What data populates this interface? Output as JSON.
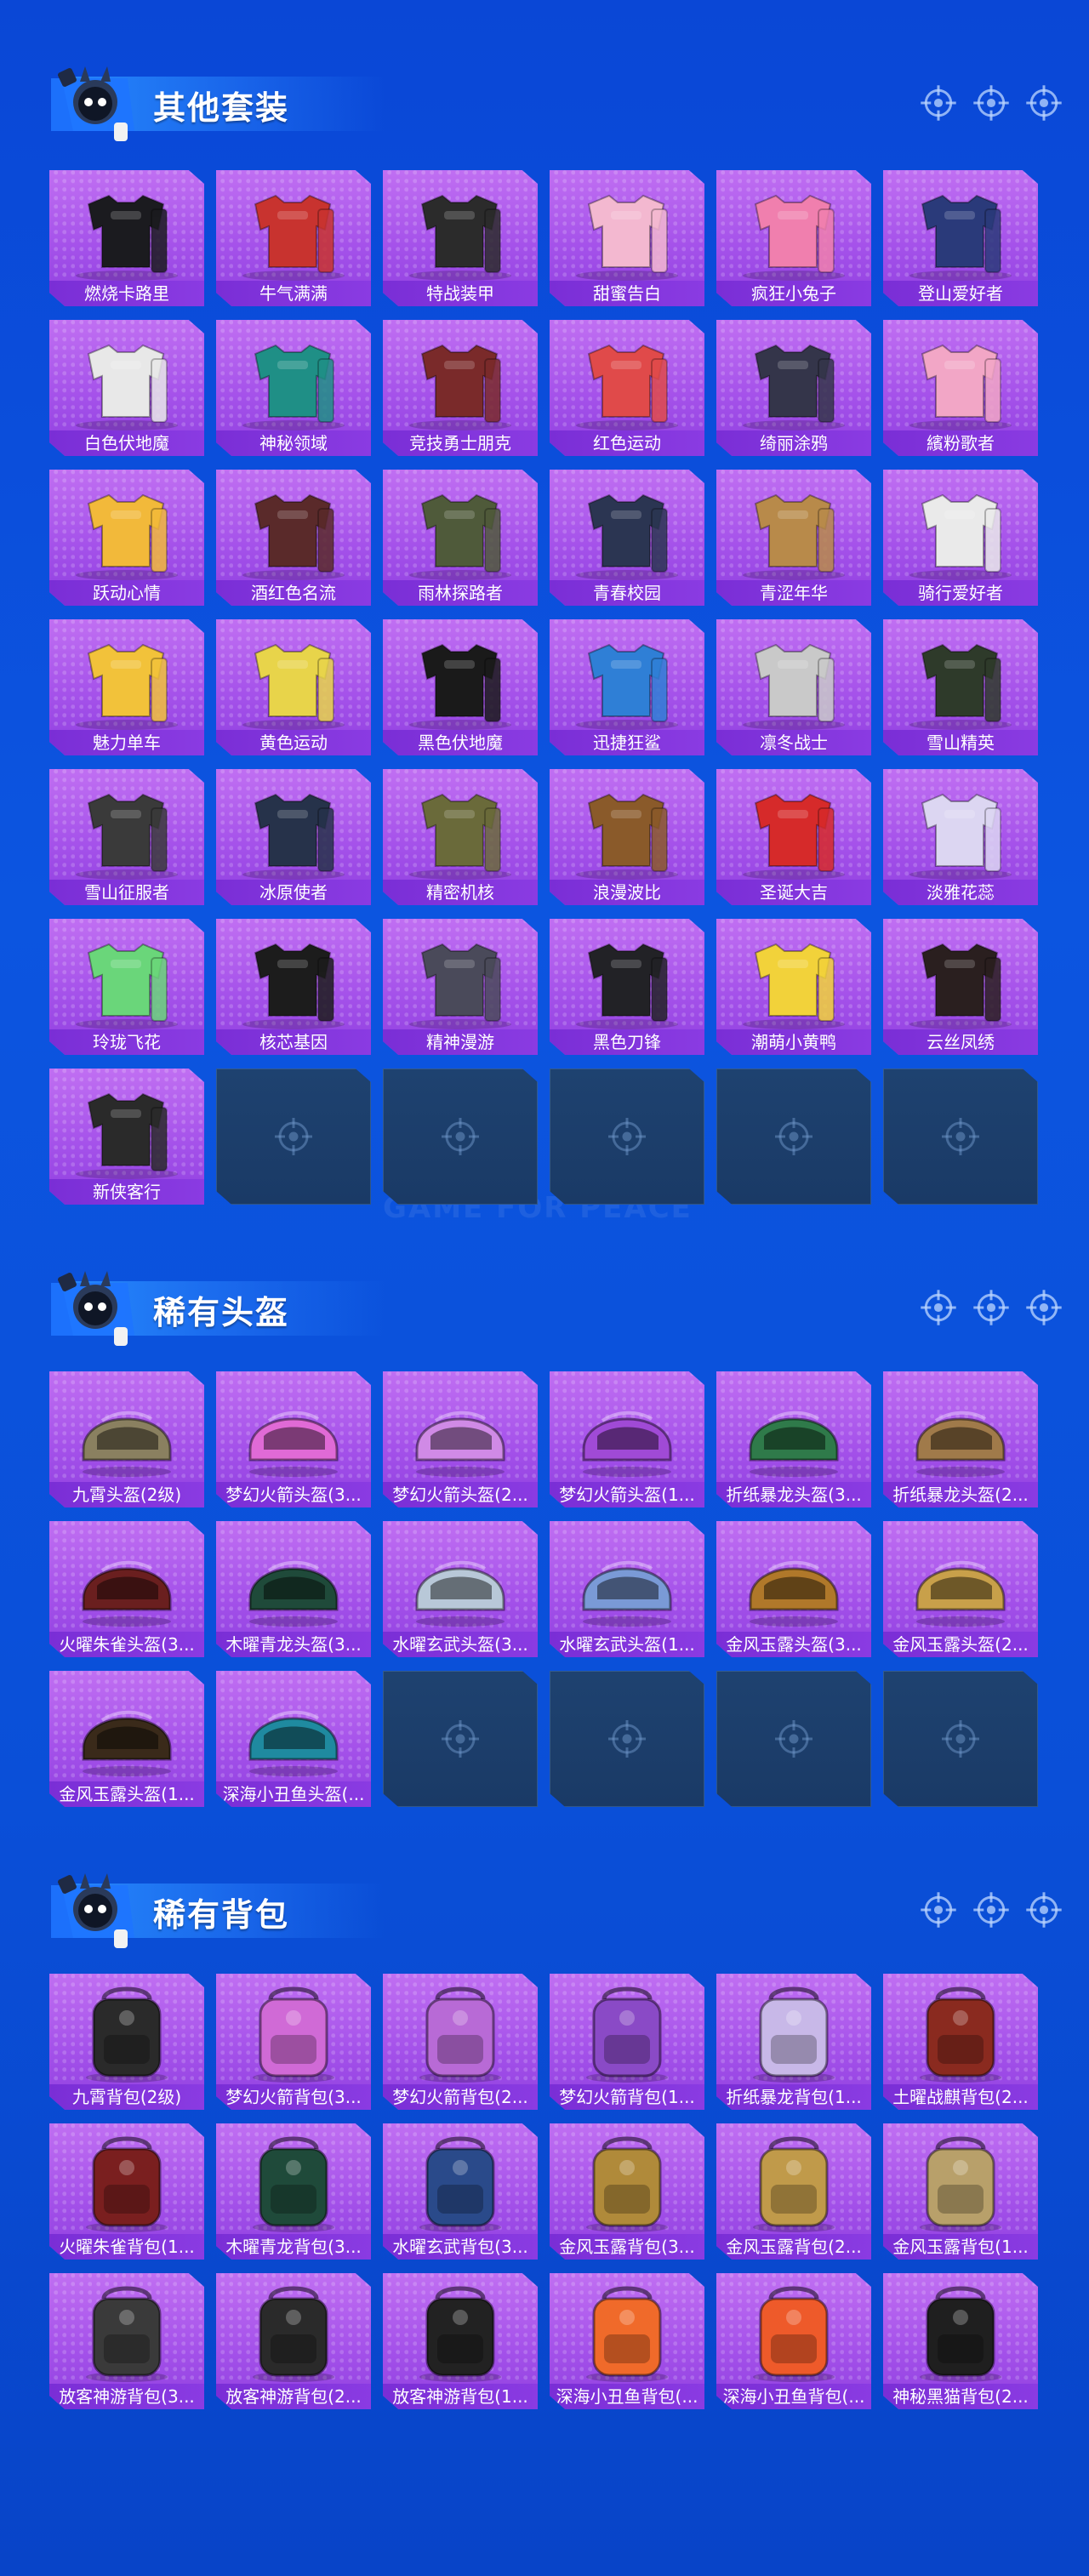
{
  "sections": [
    {
      "title": "其他套装",
      "items": [
        {
          "label": "燃烧卡路里",
          "kind": "outfit",
          "color": "#1b1b1f"
        },
        {
          "label": "牛气满满",
          "kind": "outfit",
          "color": "#c8332f"
        },
        {
          "label": "特战装甲",
          "kind": "outfit",
          "color": "#2b2b2b"
        },
        {
          "label": "甜蜜告白",
          "kind": "outfit",
          "color": "#f3b8d0"
        },
        {
          "label": "疯狂小兔子",
          "kind": "outfit",
          "color": "#f07fae"
        },
        {
          "label": "登山爱好者",
          "kind": "outfit",
          "color": "#2a3a7a"
        },
        {
          "label": "白色伏地魔",
          "kind": "outfit",
          "color": "#e8e8e8"
        },
        {
          "label": "神秘领域",
          "kind": "outfit",
          "color": "#1f8f86"
        },
        {
          "label": "竞技勇士朋克",
          "kind": "outfit",
          "color": "#7a2a2a"
        },
        {
          "label": "红色运动",
          "kind": "outfit",
          "color": "#e04a4a"
        },
        {
          "label": "绮丽涂鸦",
          "kind": "outfit",
          "color": "#34354a"
        },
        {
          "label": "繽粉歌者",
          "kind": "outfit",
          "color": "#f2a6c6"
        },
        {
          "label": "跃动心情",
          "kind": "outfit",
          "color": "#f2b93a"
        },
        {
          "label": "酒红色名流",
          "kind": "outfit",
          "color": "#5a2a2a"
        },
        {
          "label": "雨林探路者",
          "kind": "outfit",
          "color": "#4f5a3a"
        },
        {
          "label": "青春校园",
          "kind": "outfit",
          "color": "#2b3552"
        },
        {
          "label": "青涩年华",
          "kind": "outfit",
          "color": "#b88a4a"
        },
        {
          "label": "骑行爱好者",
          "kind": "outfit",
          "color": "#eaeaea"
        },
        {
          "label": "魅力单车",
          "kind": "outfit",
          "color": "#f2c23a"
        },
        {
          "label": "黄色运动",
          "kind": "outfit",
          "color": "#e8d44a"
        },
        {
          "label": "黑色伏地魔",
          "kind": "outfit",
          "color": "#1a1a1a"
        },
        {
          "label": "迅捷狂鲨",
          "kind": "outfit",
          "color": "#2f7fd6"
        },
        {
          "label": "凛冬战士",
          "kind": "outfit",
          "color": "#c9c9c9"
        },
        {
          "label": "雪山精英",
          "kind": "outfit",
          "color": "#2e3a2a"
        },
        {
          "label": "雪山征服者",
          "kind": "outfit",
          "color": "#3a3a3a"
        },
        {
          "label": "冰原使者",
          "kind": "outfit",
          "color": "#26324a"
        },
        {
          "label": "精密机核",
          "kind": "outfit",
          "color": "#6a6a3a"
        },
        {
          "label": "浪漫波比",
          "kind": "outfit",
          "color": "#8a5a2a"
        },
        {
          "label": "圣诞大吉",
          "kind": "outfit",
          "color": "#d62a2a"
        },
        {
          "label": "淡雅花蕊",
          "kind": "outfit",
          "color": "#dcd6f2"
        },
        {
          "label": "玲珑飞花",
          "kind": "outfit",
          "color": "#6ad67a"
        },
        {
          "label": "核芯基因",
          "kind": "outfit",
          "color": "#1c1c1c"
        },
        {
          "label": "精神漫游",
          "kind": "outfit",
          "color": "#4a4a5a"
        },
        {
          "label": "黑色刀锋",
          "kind": "outfit",
          "color": "#222226"
        },
        {
          "label": "潮萌小黄鸭",
          "kind": "outfit",
          "color": "#f2d23a"
        },
        {
          "label": "云丝凤绣",
          "kind": "outfit",
          "color": "#2a1f1f"
        },
        {
          "label": "新侠客行",
          "kind": "outfit",
          "color": "#2a2a2a"
        }
      ],
      "empty_slots": 5
    },
    {
      "title": "稀有头盔",
      "items": [
        {
          "label": "九霄头盔(2级)",
          "kind": "helmet",
          "color": "#8a8060"
        },
        {
          "label": "梦幻火箭头盔(3...",
          "kind": "helmet",
          "color": "#e06ad6"
        },
        {
          "label": "梦幻火箭头盔(2...",
          "kind": "helmet",
          "color": "#d08ae6"
        },
        {
          "label": "梦幻火箭头盔(1...",
          "kind": "helmet",
          "color": "#a04ad6"
        },
        {
          "label": "折纸暴龙头盔(3...",
          "kind": "helmet",
          "color": "#2f7a4a"
        },
        {
          "label": "折纸暴龙头盔(2...",
          "kind": "helmet",
          "color": "#a07a4a"
        },
        {
          "label": "火曜朱雀头盔(3...",
          "kind": "helmet",
          "color": "#6a1f1f"
        },
        {
          "label": "木曜青龙头盔(3...",
          "kind": "helmet",
          "color": "#1f4a3a"
        },
        {
          "label": "水曜玄武头盔(3...",
          "kind": "helmet",
          "color": "#b8c8d8"
        },
        {
          "label": "水曜玄武头盔(1...",
          "kind": "helmet",
          "color": "#7a9ad6"
        },
        {
          "label": "金风玉露头盔(3...",
          "kind": "helmet",
          "color": "#b0782a"
        },
        {
          "label": "金风玉露头盔(2...",
          "kind": "helmet",
          "color": "#c8a04a"
        },
        {
          "label": "金风玉露头盔(1...",
          "kind": "helmet",
          "color": "#3a2a1a"
        },
        {
          "label": "深海小丑鱼头盔(...",
          "kind": "helmet",
          "color": "#1f8aa0"
        }
      ],
      "empty_slots": 4
    },
    {
      "title": "稀有背包",
      "items": [
        {
          "label": "九霄背包(2级)",
          "kind": "backpack",
          "color": "#2a2a2a"
        },
        {
          "label": "梦幻火箭背包(3...",
          "kind": "backpack",
          "color": "#d06ad6"
        },
        {
          "label": "梦幻火箭背包(2...",
          "kind": "backpack",
          "color": "#b86ad6"
        },
        {
          "label": "梦幻火箭背包(1...",
          "kind": "backpack",
          "color": "#8a4ac6"
        },
        {
          "label": "折纸暴龙背包(1...",
          "kind": "backpack",
          "color": "#c8b8e8"
        },
        {
          "label": "土曜战麒背包(2...",
          "kind": "backpack",
          "color": "#8a2a1f"
        },
        {
          "label": "火曜朱雀背包(1...",
          "kind": "backpack",
          "color": "#7a1f1f"
        },
        {
          "label": "木曜青龙背包(3...",
          "kind": "backpack",
          "color": "#1f4a3a"
        },
        {
          "label": "水曜玄武背包(3...",
          "kind": "backpack",
          "color": "#2a4a8a"
        },
        {
          "label": "金风玉露背包(3...",
          "kind": "backpack",
          "color": "#b08a3a"
        },
        {
          "label": "金风玉露背包(2...",
          "kind": "backpack",
          "color": "#c09a4a"
        },
        {
          "label": "金风玉露背包(1...",
          "kind": "backpack",
          "color": "#b8a06a"
        },
        {
          "label": "放客神游背包(3...",
          "kind": "backpack",
          "color": "#3a3a3a"
        },
        {
          "label": "放客神游背包(2...",
          "kind": "backpack",
          "color": "#2a2a2a"
        },
        {
          "label": "放客神游背包(1...",
          "kind": "backpack",
          "color": "#222222"
        },
        {
          "label": "深海小丑鱼背包(...",
          "kind": "backpack",
          "color": "#f06a2a"
        },
        {
          "label": "深海小丑鱼背包(...",
          "kind": "backpack",
          "color": "#ee5a2a"
        },
        {
          "label": "神秘黑猫背包(2...",
          "kind": "backpack",
          "color": "#1f1f1f"
        }
      ],
      "empty_slots": 0
    }
  ],
  "icons": {
    "header_target": "crosshair-icon",
    "empty_slot": "crosshair-icon",
    "mascot": "mascot-icon"
  },
  "colors": {
    "tile_purple": "#a552ea",
    "label_purple": "#7a2ed6",
    "empty_slot": "#1e4270",
    "background_blue": "#0c55e0"
  },
  "watermark": "GAME FOR PEACE"
}
